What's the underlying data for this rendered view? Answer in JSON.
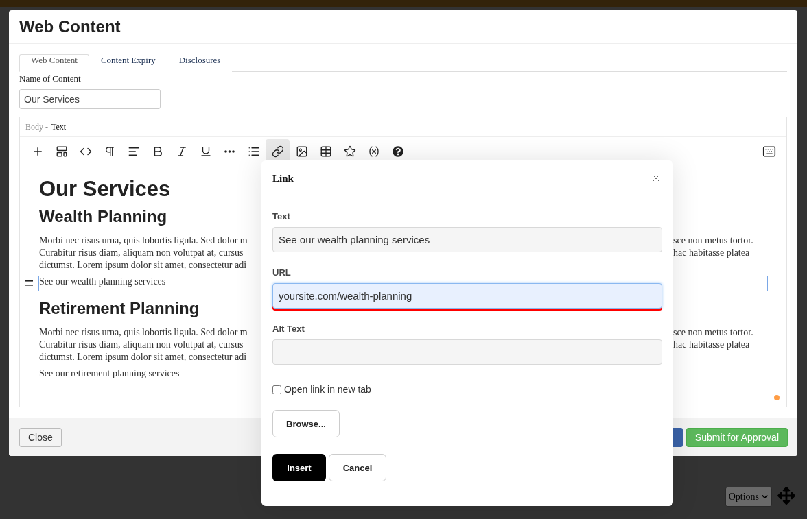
{
  "modal": {
    "title": "Web Content",
    "tabs": [
      {
        "label": "Web Content",
        "selected": true
      },
      {
        "label": "Content Expiry",
        "selected": false
      },
      {
        "label": "Disclosures",
        "selected": false
      }
    ],
    "name_field": {
      "label": "Name of Content",
      "value": "Our Services"
    },
    "editor": {
      "field_label": "Body -",
      "field_type": "Text",
      "toolbar": [
        {
          "kind": "plus",
          "active": false
        },
        {
          "kind": "template",
          "active": false
        },
        {
          "kind": "code",
          "active": false
        },
        {
          "kind": "pilcrow",
          "active": false
        },
        {
          "kind": "align",
          "active": false
        },
        {
          "kind": "bold",
          "active": false
        },
        {
          "kind": "italic",
          "active": false
        },
        {
          "kind": "underline",
          "active": false
        },
        {
          "kind": "more",
          "active": false
        },
        {
          "kind": "list",
          "active": false
        },
        {
          "kind": "link",
          "active": true
        },
        {
          "kind": "image",
          "active": false
        },
        {
          "kind": "table",
          "active": false
        },
        {
          "kind": "star",
          "active": false
        },
        {
          "kind": "variable",
          "active": false
        },
        {
          "kind": "help",
          "active": false
        }
      ],
      "content": [
        {
          "kind": "h1",
          "text": "Our Services"
        },
        {
          "kind": "h2",
          "text": "Wealth Planning"
        },
        {
          "kind": "paragraph",
          "lines": [
            {
              "left": "Morbi nec risus urna, quis lobortis ligula. Sed dolor m",
              "right": "sce non metus tortor."
            },
            {
              "left": "Curabitur risus diam, aliquam non volutpat at, cursus",
              "right": "hac habitasse platea"
            },
            {
              "left": "dictumst. Lorem ipsum dolor sit amet, consectetur adi"
            }
          ]
        },
        {
          "kind": "link",
          "text": "See our wealth planning services",
          "selected": true
        },
        {
          "kind": "h2",
          "text": "Retirement Planning"
        },
        {
          "kind": "paragraph",
          "lines": [
            {
              "left": "Morbi nec risus urna, quis lobortis ligula. Sed dolor m",
              "right": "sce non metus tortor."
            },
            {
              "left": "Curabitur risus diam, aliquam non volutpat at, cursus",
              "right": "hac habitasse platea"
            },
            {
              "left": "dictumst. Lorem ipsum dolor sit amet, consectetur adi"
            }
          ]
        },
        {
          "kind": "link",
          "text": "See our retirement planning services",
          "selected": false
        }
      ]
    },
    "footer": {
      "close": "Close",
      "submit": "Submit for Approval"
    }
  },
  "link_dialog": {
    "title": "Link",
    "fields": [
      {
        "label": "Text",
        "value": "See our wealth planning services",
        "focused": false
      },
      {
        "label": "URL",
        "value": "yoursite.com/wealth-planning",
        "focused": true
      },
      {
        "label": "Alt Text",
        "focused": false
      }
    ],
    "new_tab": {
      "label": "Open link in new tab",
      "checked": false
    },
    "browse": "Browse...",
    "insert": "Insert",
    "cancel": "Cancel"
  },
  "background": {
    "options": "Options"
  }
}
